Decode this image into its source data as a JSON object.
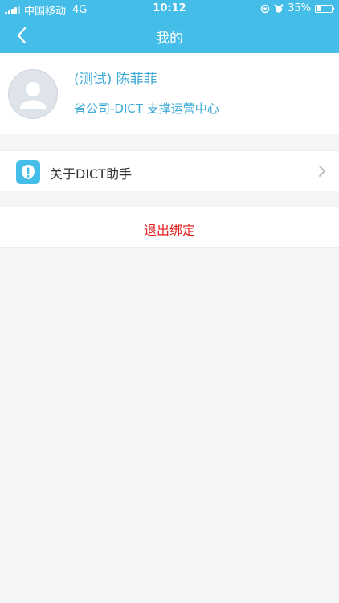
{
  "status_bar": {
    "carrier": "中国移动",
    "network": "4G",
    "time": "10:12",
    "battery_text": "35%",
    "battery_level": 0.35
  },
  "nav": {
    "title": "我的",
    "back_icon": "chevron-left-icon"
  },
  "profile": {
    "name": "(测试) 陈菲菲",
    "department": "省公司-DICT 支撑运营中心",
    "avatar_icon": "user-avatar-icon"
  },
  "menu": {
    "about_label": "关于DICT助手",
    "about_icon": "info-icon",
    "arrow_icon": "chevron-right-icon"
  },
  "actions": {
    "logout_label": "退出绑定"
  },
  "colors": {
    "brand": "#44bde8",
    "link_text": "#3aa9d6",
    "danger": "#e41d1d",
    "background": "#f5f5f5"
  }
}
